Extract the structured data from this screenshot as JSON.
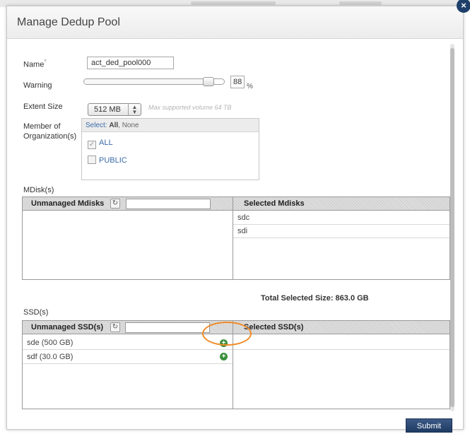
{
  "dialog": {
    "title": "Manage Dedup Pool",
    "close_glyph": "×"
  },
  "form": {
    "name": {
      "label": "Name",
      "required_mark": "*",
      "value": "act_ded_pool000"
    },
    "warning": {
      "label": "Warning",
      "value": "88",
      "unit": "%",
      "slider_fraction": 0.88
    },
    "extent_size": {
      "label": "Extent Size",
      "selected": "512 MB",
      "hint": "Max supported volume 64 TB"
    },
    "organization": {
      "label_line1": "Member of",
      "label_line2": "Organization(s)",
      "header_select": "Select:",
      "header_all": "All",
      "header_sep": ",",
      "header_none": "None",
      "items": [
        {
          "label": "ALL",
          "checked": true
        },
        {
          "label": "PUBLIC",
          "checked": false
        }
      ]
    }
  },
  "mdisks": {
    "section_label": "MDisk(s)",
    "unmanaged_header": "Unmanaged Mdisks",
    "selected_header": "Selected Mdisks",
    "unmanaged_rows": [],
    "selected_rows": [
      "sdc",
      "sdi"
    ],
    "total_selected": "Total Selected Size: 863.0 GB"
  },
  "ssds": {
    "section_label": "SSD(s)",
    "unmanaged_header": "Unmanaged SSD(s)",
    "selected_header": "Selected SSD(s)",
    "unmanaged_rows": [
      "sde (500 GB)",
      "sdf (30.0 GB)"
    ],
    "selected_rows": []
  },
  "buttons": {
    "submit": "Submit"
  },
  "icons": {
    "refresh": "refresh-icon",
    "add": "add-icon",
    "spinner": "spinner-arrows-icon",
    "close": "close-icon"
  },
  "colors": {
    "submit_bg": "#1f3b63",
    "add_green": "#3c8f3c",
    "highlight_ring": "#f08a24",
    "link_blue": "#3a6aa8"
  }
}
